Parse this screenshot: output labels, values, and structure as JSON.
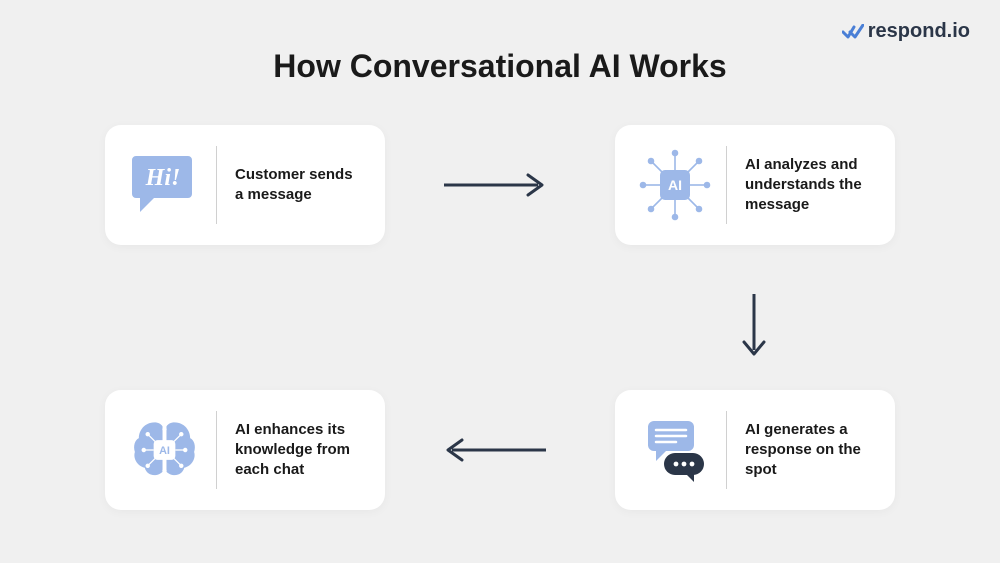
{
  "brand": {
    "name": "respond.io"
  },
  "title": "How Conversational AI Works",
  "colors": {
    "icon_blue": "#9db8e8",
    "dark": "#2b3648"
  },
  "steps": [
    {
      "id": "step-1",
      "label": "Customer sends a message",
      "icon": "hi-speech-bubble"
    },
    {
      "id": "step-2",
      "label": "AI analyzes and understands the message",
      "icon": "ai-chip-network"
    },
    {
      "id": "step-3",
      "label": "AI generates a response on the spot",
      "icon": "chat-bubbles"
    },
    {
      "id": "step-4",
      "label": "AI enhances its knowledge from each chat",
      "icon": "ai-brain"
    }
  ]
}
